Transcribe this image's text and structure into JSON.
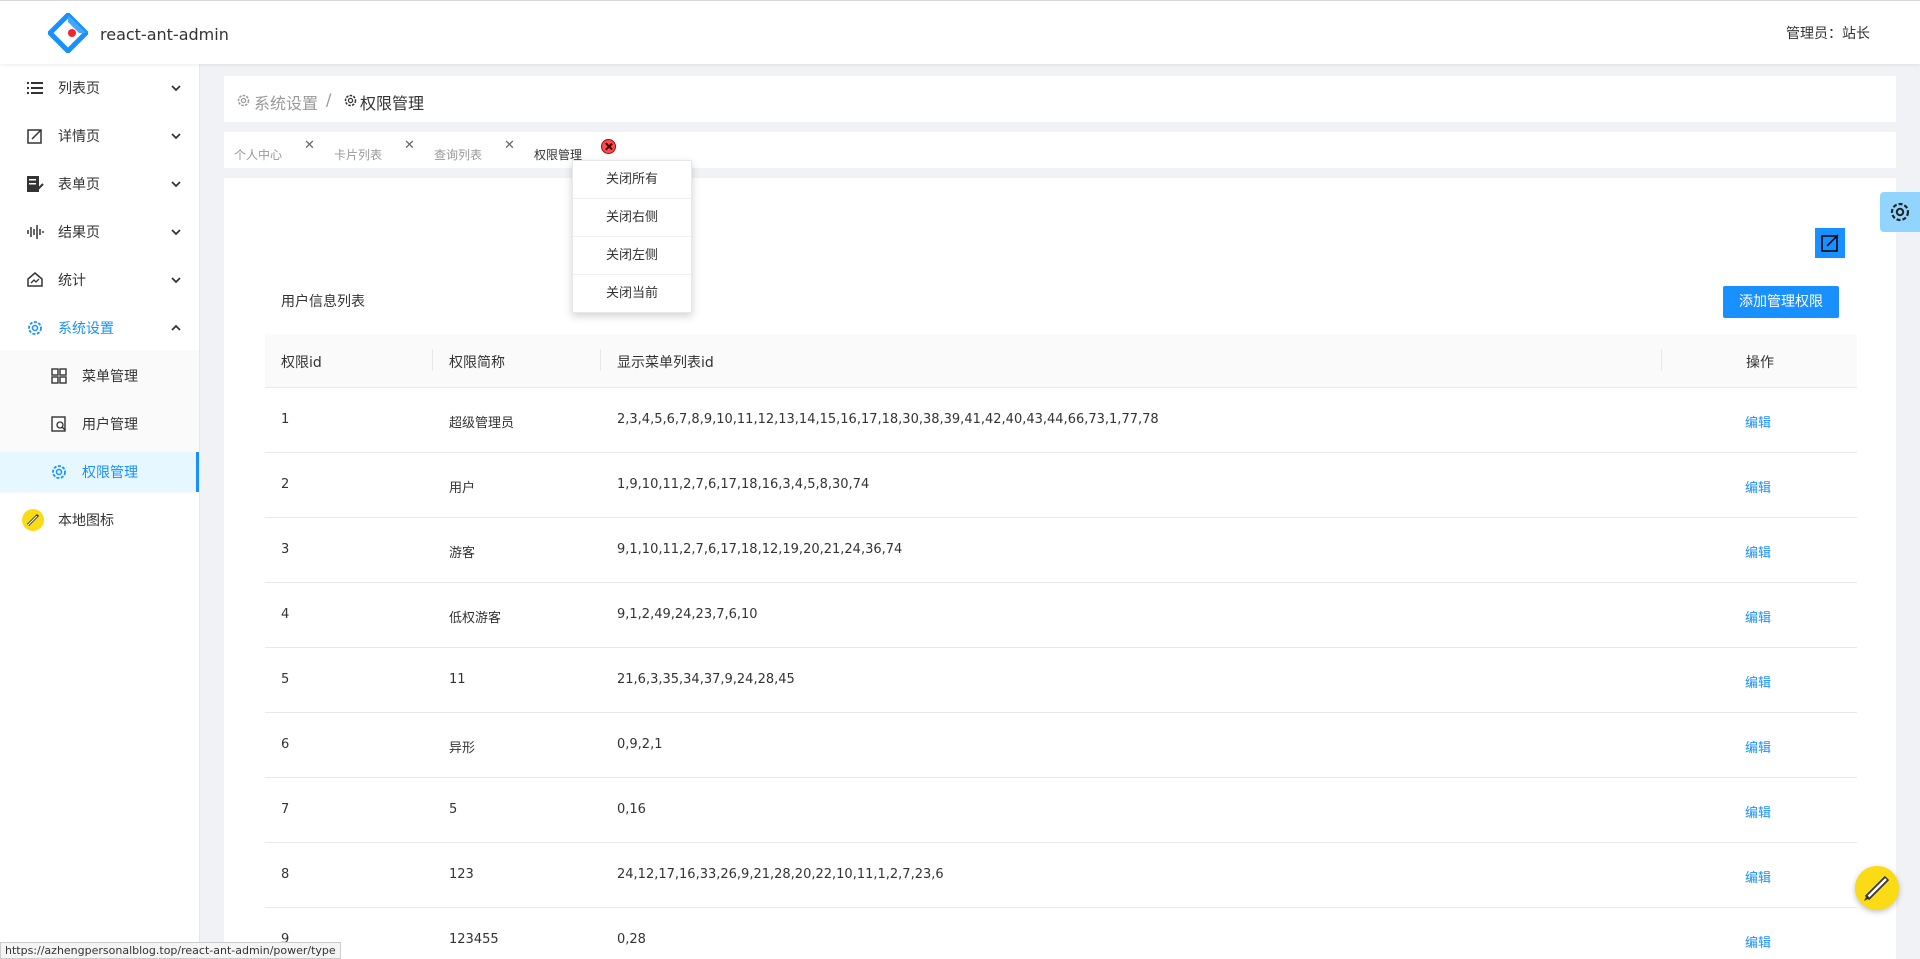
{
  "header": {
    "app_title": "react-ant-admin",
    "user_info": "管理员：站长"
  },
  "sidebar": {
    "items": [
      {
        "label": "列表页",
        "icon": "list-icon"
      },
      {
        "label": "详情页",
        "icon": "form-edit-icon"
      },
      {
        "label": "表单页",
        "icon": "document-edit-icon"
      },
      {
        "label": "结果页",
        "icon": "audio-icon"
      },
      {
        "label": "统计",
        "icon": "fund-icon"
      },
      {
        "label": "系统设置",
        "icon": "setting-icon"
      },
      {
        "label": "菜单管理",
        "icon": "appstore-icon"
      },
      {
        "label": "用户管理",
        "icon": "user-form-icon"
      },
      {
        "label": "权限管理",
        "icon": "setting-icon"
      },
      {
        "label": "本地图标",
        "icon": "pencil-icon"
      }
    ]
  },
  "breadcrumb": {
    "parent": "系统设置",
    "separator": "/",
    "current": "权限管理"
  },
  "tabs": [
    {
      "label": "个人中心"
    },
    {
      "label": "卡片列表"
    },
    {
      "label": "查询列表"
    },
    {
      "label": "权限管理"
    }
  ],
  "tab_menu": [
    "关闭所有",
    "关闭右侧",
    "关闭左侧",
    "关闭当前"
  ],
  "card": {
    "title": "用户信息列表",
    "add_button": "添加管理权限"
  },
  "table": {
    "columns": [
      "权限id",
      "权限简称",
      "显示菜单列表id",
      "操作"
    ],
    "action_label": "编辑",
    "rows": [
      {
        "id": "1",
        "name": "超级管理员",
        "menus": "2,3,4,5,6,7,8,9,10,11,12,13,14,15,16,17,18,30,38,39,41,42,40,43,44,66,73,1,77,78"
      },
      {
        "id": "2",
        "name": "用户",
        "menus": "1,9,10,11,2,7,6,17,18,16,3,4,5,8,30,74"
      },
      {
        "id": "3",
        "name": "游客",
        "menus": "9,1,10,11,2,7,6,17,18,12,19,20,21,24,36,74"
      },
      {
        "id": "4",
        "name": "低权游客",
        "menus": "9,1,2,49,24,23,7,6,10"
      },
      {
        "id": "5",
        "name": "11",
        "menus": "21,6,3,35,34,37,9,24,28,45"
      },
      {
        "id": "6",
        "name": "异形",
        "menus": "0,9,2,1"
      },
      {
        "id": "7",
        "name": "5",
        "menus": "0,16"
      },
      {
        "id": "8",
        "name": "123",
        "menus": "24,12,17,16,33,26,9,21,28,20,22,10,11,1,2,7,23,6"
      },
      {
        "id": "9",
        "name": "123455",
        "menus": "0,28"
      }
    ]
  },
  "status_url": "https://azhengpersonalblog.top/react-ant-admin/power/type",
  "colors": {
    "primary": "#1890ff",
    "background": "#f0f2f5"
  }
}
